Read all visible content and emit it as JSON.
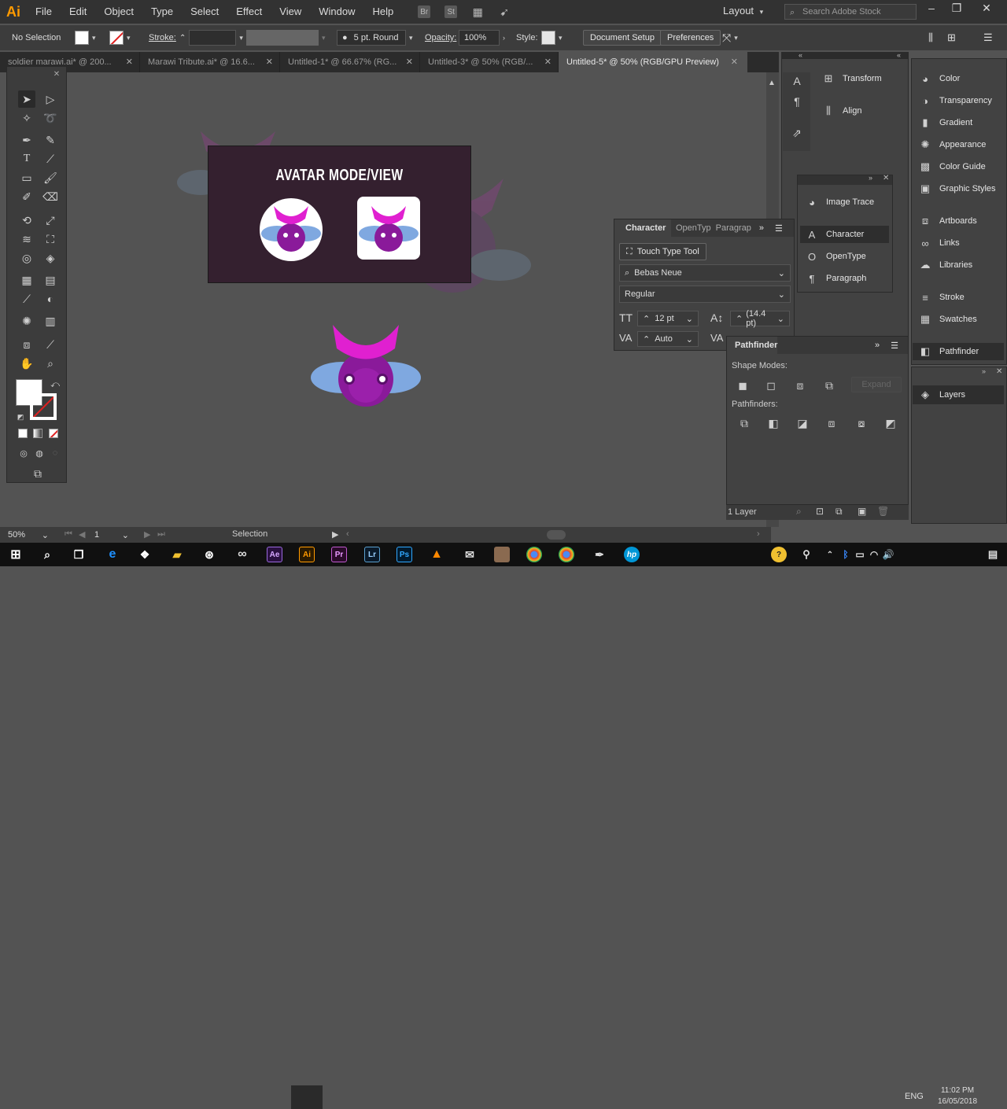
{
  "app": {
    "logo": "Ai"
  },
  "menu": [
    "File",
    "Edit",
    "Object",
    "Type",
    "Select",
    "Effect",
    "View",
    "Window",
    "Help"
  ],
  "menubar_icons": [
    "Br",
    "St"
  ],
  "workspace": {
    "label": "Layout"
  },
  "search": {
    "placeholder": "Search Adobe Stock"
  },
  "controlbar": {
    "selection": "No Selection",
    "stroke_label": "Stroke:",
    "brush": "5 pt. Round",
    "opacity_label": "Opacity:",
    "opacity_value": "100%",
    "style_label": "Style:",
    "document_setup": "Document Setup",
    "preferences": "Preferences"
  },
  "tabs": [
    {
      "label": "soldier marawi.ai* @ 200..."
    },
    {
      "label": "Marawi Tribute.ai* @ 16.6..."
    },
    {
      "label": "Untitled-1* @ 66.67% (RG..."
    },
    {
      "label": "Untitled-3* @ 50% (RGB/..."
    },
    {
      "label": "Untitled-5* @ 50% (RGB/GPU Preview)"
    }
  ],
  "artboard": {
    "title": "AVATAR MODE/VIEW"
  },
  "character_panel": {
    "tabs": [
      "Character",
      "OpenTyp",
      "Paragrap"
    ],
    "touch_type": "Touch Type Tool",
    "font_family": "Bebas Neue",
    "font_style": "Regular",
    "font_size": "12 pt",
    "leading": "(14.4 pt)",
    "tracking": "Auto"
  },
  "mid_panel": {
    "items": [
      "Transform",
      "Align"
    ],
    "float_items": [
      "Image Trace",
      "Character",
      "OpenType",
      "Paragraph"
    ]
  },
  "right_panel": {
    "items": [
      "Color",
      "Transparency",
      "Gradient",
      "Appearance",
      "Color Guide",
      "Graphic Styles",
      "Artboards",
      "Links",
      "Libraries",
      "Stroke",
      "Swatches",
      "Pathfinder"
    ],
    "layers": "Layers"
  },
  "pathfinder": {
    "title": "Pathfinder",
    "shape_modes": "Shape Modes:",
    "pathfinders": "Pathfinders:",
    "expand": "Expand",
    "layer_count": "1 Layer"
  },
  "status": {
    "zoom": "50%",
    "page": "1",
    "tool": "Selection"
  },
  "taskbar": {
    "language": "ENG",
    "time": "11:02 PM",
    "date": "16/05/2018",
    "apps": [
      "Ae",
      "Ai",
      "Pr",
      "Lr",
      "Ps"
    ]
  },
  "colors": {
    "accent_ai": "#ff9a00",
    "magenta": "#e020d0",
    "purple": "#8a1a9a",
    "wing": "#8ab8e8"
  }
}
